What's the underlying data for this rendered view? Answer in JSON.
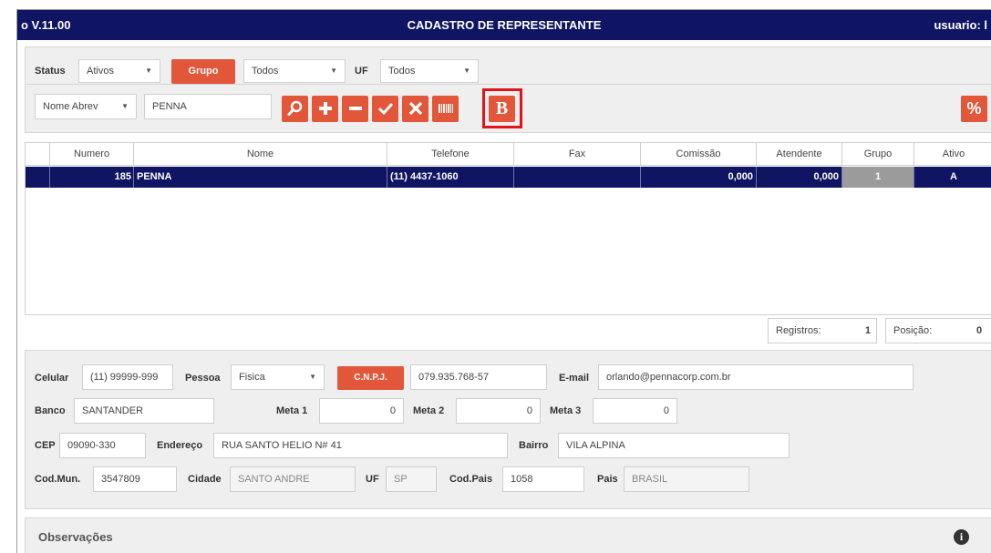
{
  "header": {
    "version": "o V.11.00",
    "title": "CADASTRO DE REPRESENTANTE",
    "user": "usuario: l"
  },
  "filters": {
    "status_label": "Status",
    "status_value": "Ativos",
    "grupo_button": "Grupo",
    "grupo_value": "Todos",
    "uf_label": "UF",
    "uf_value": "Todos",
    "search_field": "Nome Abrev",
    "search_value": "PENNA"
  },
  "toolbar": {
    "search_icon": "search-icon",
    "add_icon": "plus-icon",
    "remove_icon": "minus-icon",
    "confirm_icon": "check-icon",
    "cancel_icon": "x-icon",
    "barcode_icon": "barcode-icon",
    "bold_icon": "bold-b-icon",
    "percent_icon": "percent-icon",
    "bold_symbol": "B",
    "percent_symbol": "%"
  },
  "table": {
    "columns": [
      "Numero",
      "Nome",
      "Telefone",
      "Fax",
      "Comissão",
      "Atendente",
      "Grupo",
      "Ativo"
    ],
    "rows": [
      {
        "numero": "185",
        "nome": "PENNA",
        "telefone": "(11) 4437-1060",
        "fax": "",
        "comissao": "0,000",
        "atendente": "0,000",
        "grupo": "1",
        "ativo": "A"
      }
    ]
  },
  "status": {
    "registros_label": "Registros:",
    "registros_value": "1",
    "posicao_label": "Posição:",
    "posicao_value": "0"
  },
  "form": {
    "celular_label": "Celular",
    "celular_value": "(11) 99999-999",
    "pessoa_label": "Pessoa",
    "pessoa_value": "Fisica",
    "cnpj_button": "C.N.P.J.",
    "cnpj_value": "079.935.768-57",
    "email_label": "E-mail",
    "email_value": "orlando@pennacorp.com.br",
    "banco_label": "Banco",
    "banco_value": "SANTANDER",
    "meta1_label": "Meta 1",
    "meta1_value": "0",
    "meta2_label": "Meta 2",
    "meta2_value": "0",
    "meta3_label": "Meta 3",
    "meta3_value": "0",
    "cep_label": "CEP",
    "cep_value": "09090-330",
    "endereco_label": "Endereço",
    "endereco_value": "RUA SANTO HELIO N# 41",
    "bairro_label": "Bairro",
    "bairro_value": "VILA ALPINA",
    "codmun_label": "Cod.Mun.",
    "codmun_value": "3547809",
    "cidade_label": "Cidade",
    "cidade_value": "SANTO ANDRE",
    "uf_label": "UF",
    "uf_value": "SP",
    "codpais_label": "Cod.Pais",
    "codpais_value": "1058",
    "pais_label": "Pais",
    "pais_value": "BRASIL"
  },
  "observacoes": {
    "label": "Observações",
    "info_icon": "info-icon",
    "info_symbol": "i"
  },
  "colors": {
    "title_bar": "#0f1463",
    "accent": "#e2563a",
    "highlight": "#e1141b",
    "selected_row": "#0f1463"
  }
}
